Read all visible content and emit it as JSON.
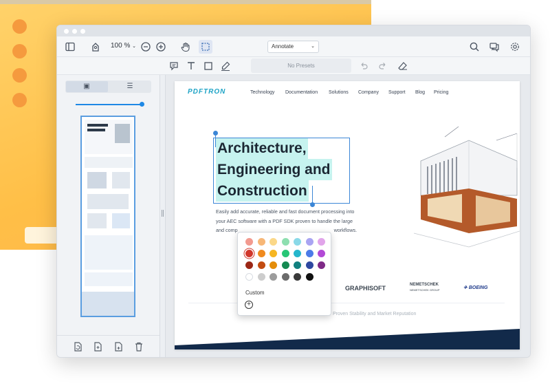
{
  "toolbar": {
    "zoom_label": "100 %",
    "mode_value": "Annotate",
    "icons": [
      "sidebar-toggle-icon",
      "pan-icon",
      "zoom-out-icon",
      "zoom-in-icon",
      "hand-icon",
      "area-select-icon",
      "search-icon",
      "comments-icon",
      "settings-icon"
    ]
  },
  "subtoolbar": {
    "presets_label": "No Presets",
    "tools": [
      "comment-icon",
      "text-icon",
      "rectangle-icon",
      "pen-icon",
      "undo-icon",
      "redo-icon",
      "eraser-icon"
    ]
  },
  "document": {
    "logo": "PDFTRON",
    "nav": [
      "Technology",
      "Documentation",
      "Solutions",
      "Company",
      "Support",
      "Blog",
      "Pricing"
    ],
    "headline_lines": [
      "Architecture,",
      "Engineering and",
      "Construction"
    ],
    "body_lines": [
      "Easily add accurate, reliable and fast document processing into",
      "your AEC software with a PDF SDK proven to handle the large",
      "and comp",
      "workflows."
    ],
    "brands": [
      "GRAPHISOFT",
      "NEMETSCHEK",
      "BOEING"
    ],
    "brand_sub": "NEMETSCHEK GROUP",
    "tagline": "Proven Stability and Market Reputation"
  },
  "palette": {
    "custom_label": "Custom",
    "selected": "#d1372b",
    "rows": [
      [
        "#f29a8f",
        "#f7b777",
        "#fbd889",
        "#8edfb0",
        "#8ad9e8",
        "#a9a4f2",
        "#e1a5ea"
      ],
      [
        "#d1372b",
        "#f08a1f",
        "#f6b622",
        "#27c676",
        "#25b6cc",
        "#4c7be8",
        "#b24ad6"
      ],
      [
        "#9b2716",
        "#c24c11",
        "#e48d0a",
        "#158a52",
        "#12807f",
        "#2e48a0",
        "#7f2a87"
      ],
      [
        "#ffffff",
        "#cdcdcd",
        "#9c9c9c",
        "#6b6b6b",
        "#3a3a3a",
        "#111111"
      ]
    ]
  }
}
